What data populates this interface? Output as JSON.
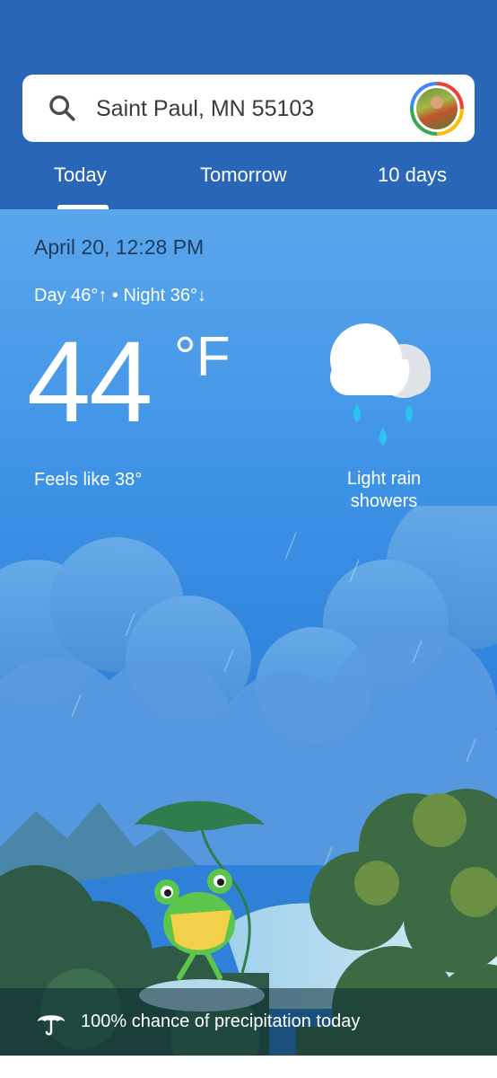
{
  "search": {
    "location": "Saint Paul, MN 55103"
  },
  "tabs": [
    {
      "label": "Today",
      "selected": true
    },
    {
      "label": "Tomorrow",
      "selected": false
    },
    {
      "label": "10 days",
      "selected": false
    }
  ],
  "current": {
    "datetime": "April 20, 12:28 PM",
    "day_night": "Day 46°↑ • Night 36°↓",
    "temperature": "44",
    "unit": "°F",
    "feels_like": "Feels like 38°",
    "condition": "Light rain showers",
    "condition_icon": "cloud-rain-icon"
  },
  "precipitation": {
    "text": "100% chance of precipitation today",
    "icon": "umbrella-icon"
  },
  "colors": {
    "header": "#2a66b8",
    "sky": "#3f93e6",
    "raindrop": "#29c4f0"
  }
}
